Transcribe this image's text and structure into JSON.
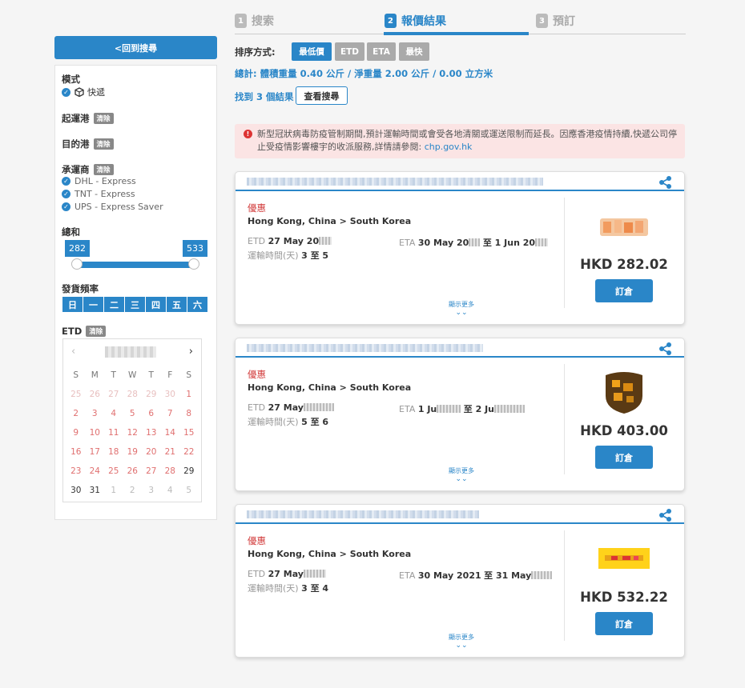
{
  "sidebar": {
    "back_label": "<回到搜尋",
    "clear_label": "清除",
    "mode_title": "模式",
    "mode_value": "快遞",
    "origin_title": "起運港",
    "dest_title": "目的港",
    "carrier_title": "承運商",
    "carriers": [
      "DHL - Express",
      "TNT - Express",
      "UPS - Express Saver"
    ],
    "total_title": "總和",
    "range_min": "282",
    "range_max": "533",
    "freq_title": "發貨頻率",
    "freq_days": [
      "日",
      "一",
      "二",
      "三",
      "四",
      "五",
      "六"
    ],
    "etd_title": "ETD",
    "calendar": {
      "prev_icon": "‹",
      "next_icon": "›",
      "dow": [
        "S",
        "M",
        "T",
        "W",
        "T",
        "F",
        "S"
      ],
      "weeks": [
        [
          "25",
          "26",
          "27",
          "28",
          "29",
          "30",
          "1"
        ],
        [
          "2",
          "3",
          "4",
          "5",
          "6",
          "7",
          "8"
        ],
        [
          "9",
          "10",
          "11",
          "12",
          "13",
          "14",
          "15"
        ],
        [
          "16",
          "17",
          "18",
          "19",
          "20",
          "21",
          "22"
        ],
        [
          "23",
          "24",
          "25",
          "26",
          "27",
          "28",
          "29"
        ],
        [
          "30",
          "31",
          "1",
          "2",
          "3",
          "4",
          "5"
        ]
      ]
    }
  },
  "steps": [
    {
      "num": "1",
      "label": "搜索"
    },
    {
      "num": "2",
      "label": "報價結果"
    },
    {
      "num": "3",
      "label": "預訂"
    }
  ],
  "sort": {
    "label": "排序方式:",
    "options": [
      "最低價",
      "ETD",
      "ETA",
      "最快"
    ]
  },
  "totals": "總計: 體積重量 0.40 公斤 / 淨重量 2.00 公斤 / 0.00 立方米",
  "found": "找到 3 個結果",
  "view_search": "查看搜尋",
  "notice": {
    "text": "新型冠狀病毒防疫管制期間,預計運輸時間或會受各地清關或運送限制而延長。因應香港疫情持續,快遞公司停止受疫情影響樓宇的收派服務,詳情請參閱: ",
    "link": "chp.gov.hk"
  },
  "quotes": [
    {
      "offer": "優惠",
      "route": "Hong Kong, China > South Korea",
      "etd_label": "ETD",
      "etd": "27 May 20",
      "eta_label": "ETA",
      "eta": "30 May 20",
      "eta_to": "至 1 Jun 20",
      "transit_label": "運輸時間(天)",
      "transit": "3 至 5",
      "more": "顯示更多",
      "price": "HKD 282.02",
      "book": "訂倉"
    },
    {
      "offer": "優惠",
      "route": "Hong Kong, China > South Korea",
      "etd_label": "ETD",
      "etd": "27 May",
      "eta_label": "ETA",
      "eta": "1 Ju",
      "eta_to": "至 2 Ju",
      "transit_label": "運輸時間(天)",
      "transit": "5 至 6",
      "more": "顯示更多",
      "price": "HKD 403.00",
      "book": "訂倉"
    },
    {
      "offer": "優惠",
      "route": "Hong Kong, China > South Korea",
      "etd_label": "ETD",
      "etd": "27 May",
      "eta_label": "ETA",
      "eta": "30 May 2021",
      "eta_to": "至 31 May",
      "transit_label": "運輸時間(天)",
      "transit": "3 至 4",
      "more": "顯示更多",
      "price": "HKD 532.22",
      "book": "訂倉"
    }
  ],
  "colors": {
    "accent": "#2a86c8",
    "offer_red": "#d23a3a",
    "notice_bg": "#fbe4e4",
    "sort_active": "#2a86c8",
    "sort_inactive": "#aaaaaa"
  }
}
